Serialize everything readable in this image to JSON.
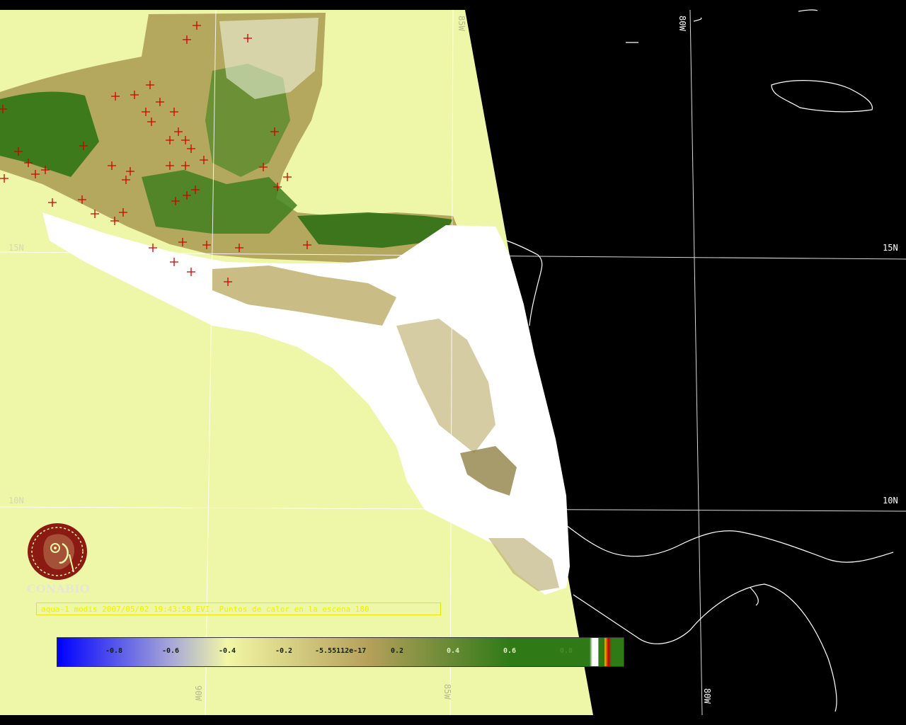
{
  "map": {
    "lat_labels": [
      "15N",
      "15N",
      "10N",
      "10N"
    ],
    "lon_labels": [
      "85W",
      "80W",
      "90W",
      "85W",
      "80W"
    ],
    "land_colors": {
      "background": "#eef6a8",
      "night": "#000000",
      "coast": "#ffffff",
      "hot_spot": "#cc0000",
      "vegetation": "#3f7f1f"
    }
  },
  "logo": {
    "text": "CONABIO",
    "icon": "conabio-macaw-logo-icon",
    "color": "#8b1a12"
  },
  "caption": {
    "text": "aqua-1 modis 2007/05/02 19:43:58 EVI. Puntos de calor en la escena 180"
  },
  "colorbar": {
    "ticks": [
      "-0.8",
      "-0.6",
      "-0.4",
      "-0.2",
      "-5.55112e-17",
      "0.2",
      "0.4",
      "0.6",
      "0.8"
    ],
    "colors": [
      "#0000ff",
      "#a6a6d8",
      "#f2f7a5",
      "#b5a05a",
      "#2f7a17",
      "#ffffff",
      "#cc0000",
      "#e6c000"
    ]
  }
}
